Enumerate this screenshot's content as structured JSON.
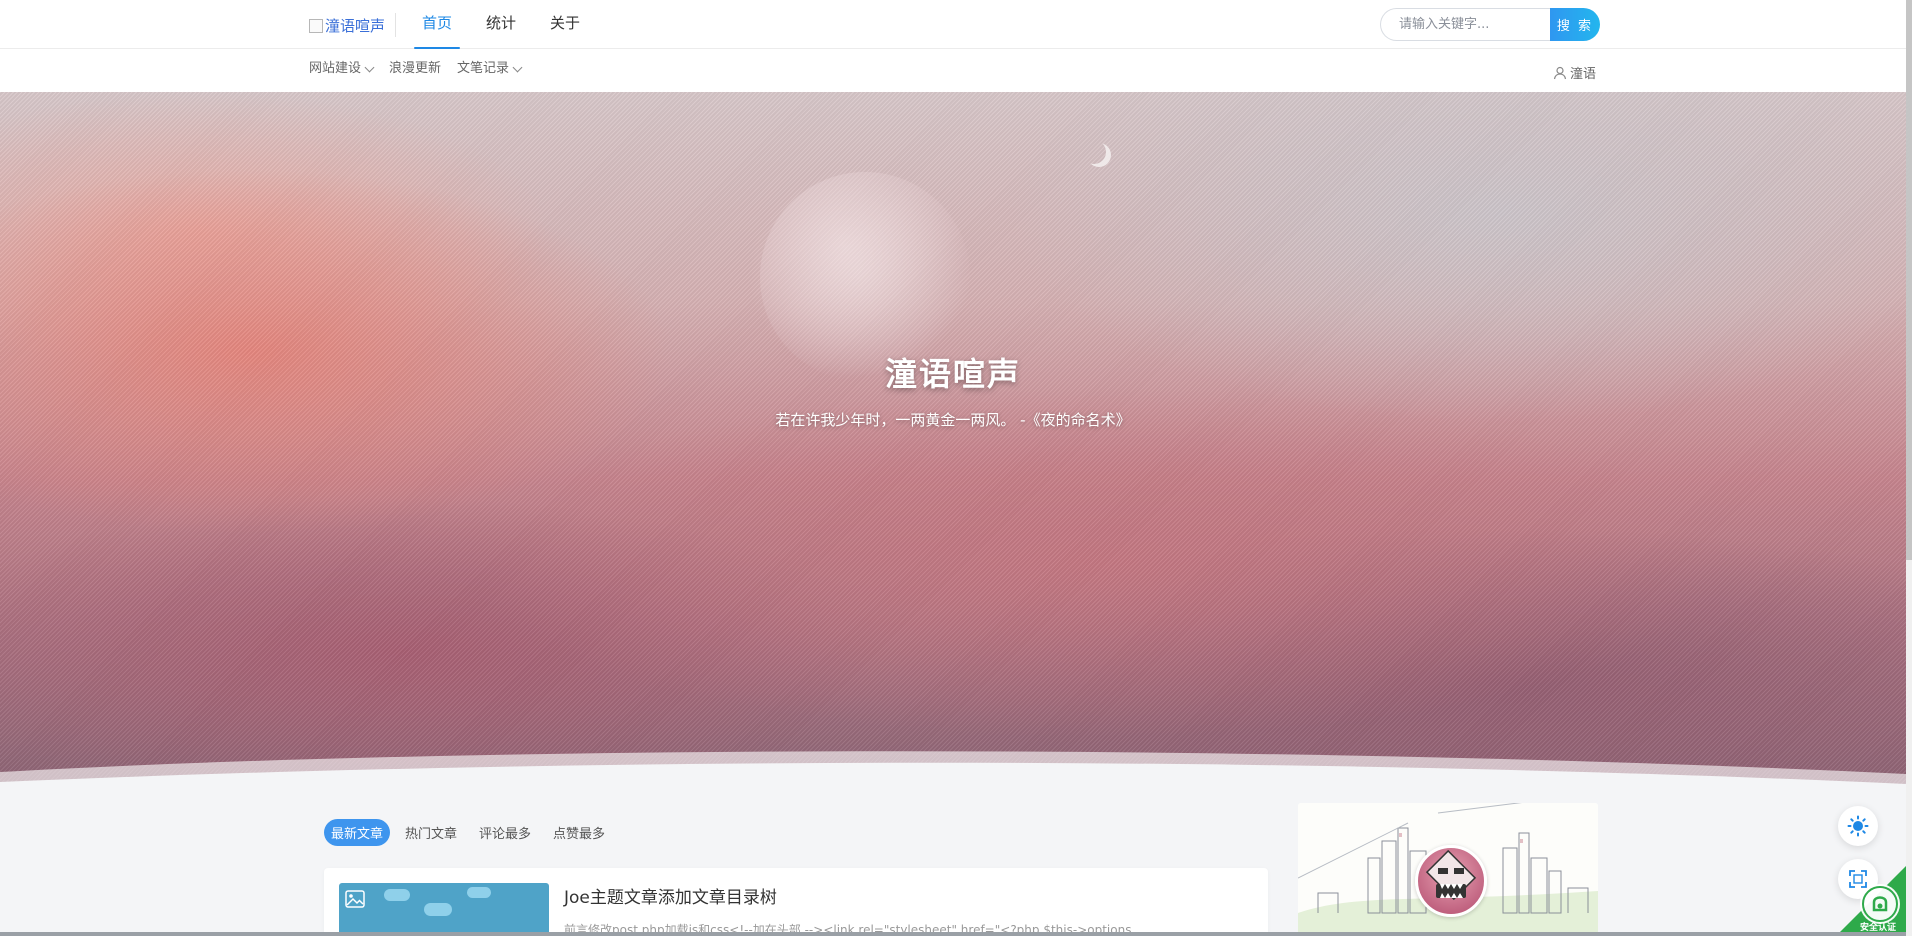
{
  "header": {
    "logo_text": "潼语喧声",
    "nav": [
      {
        "label": "首页",
        "active": true
      },
      {
        "label": "统计",
        "active": false
      },
      {
        "label": "关于",
        "active": false
      }
    ],
    "search": {
      "placeholder": "请输入关键字...",
      "button_label": "搜 索"
    }
  },
  "subnav": {
    "items": [
      {
        "label": "网站建设",
        "has_dropdown": true
      },
      {
        "label": "浪漫更新",
        "has_dropdown": false
      },
      {
        "label": "文笔记录",
        "has_dropdown": true
      }
    ],
    "user_label": "潼语"
  },
  "hero": {
    "title": "潼语喧声",
    "subtitle": "若在许我少年时，一两黄金一两风。 -《夜的命名术》"
  },
  "content": {
    "tabs": [
      {
        "label": "最新文章",
        "active": true
      },
      {
        "label": "热门文章",
        "active": false
      },
      {
        "label": "评论最多",
        "active": false
      },
      {
        "label": "点赞最多",
        "active": false
      }
    ],
    "post": {
      "title": "Joe主题文章添加文章目录树",
      "excerpt": "前言修改post.php加载js和css<!--加在头部 --><link rel=\"stylesheet\" href=\"<?php $this->options"
    }
  },
  "floating": {
    "badge_label": "安全认证"
  },
  "colors": {
    "accent": "#1e88e5",
    "search_button": "#2fa6ef",
    "tab_active": "#3e95ee",
    "badge": "#2eaa4a"
  },
  "icons": {
    "theme_toggle": "sun-icon",
    "fullscreen": "fullscreen-icon",
    "user": "user-icon",
    "post_thumb": "image-icon"
  }
}
